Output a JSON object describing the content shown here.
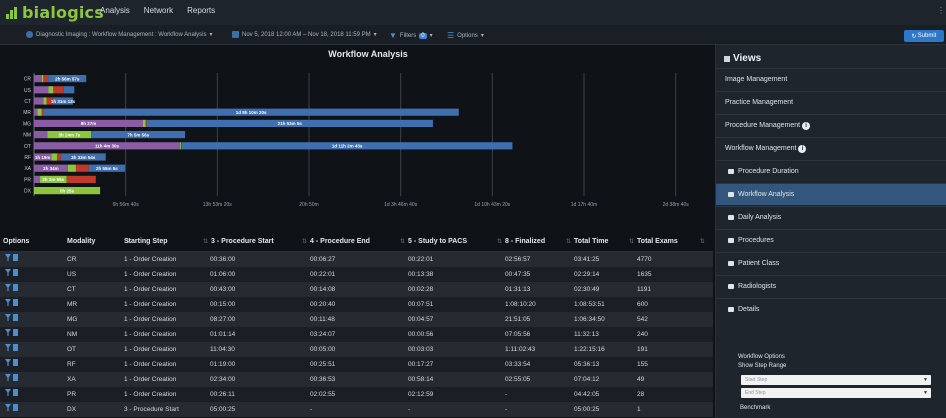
{
  "app": {
    "name": "bialogics"
  },
  "nav": [
    "Analysis",
    "Network",
    "Reports"
  ],
  "subbar": {
    "breadcrumb": "Diagnostic Imaging : Workflow Management : Workflow Analysis",
    "daterange": "Nov 5, 2018 12:00 AM – Nov 18, 2018 11:59 PM",
    "filters_label": "Filters",
    "filters_count": "0",
    "options_label": "Options",
    "submit_label": "Submit"
  },
  "chart_data": {
    "type": "bar",
    "orientation": "horizontal-stacked",
    "title": "Workflow Analysis",
    "categories": [
      "CR",
      "US",
      "CT",
      "MR",
      "MG",
      "NM",
      "OT",
      "RF",
      "XA",
      "PR",
      "DX"
    ],
    "x_tick_labels": [
      "6h 56m 40s",
      "13h 53m 20s",
      "20h 50m",
      "1d 3h 46m 40s",
      "1d 10h 43m 20s",
      "1d 17h 40m",
      "2d 38m 40s"
    ],
    "x_tick_seconds": [
      25000,
      50000,
      75000,
      100000,
      125000,
      150000,
      175000
    ],
    "xlim_seconds": [
      0,
      180000
    ],
    "grid": true,
    "series": [
      {
        "color": "#8a5ca3",
        "values": [
          2160,
          3960,
          2580,
          900,
          29700,
          3674,
          39840,
          4740,
          9240,
          1571,
          0
        ]
      },
      {
        "color": "#8cc63f",
        "values": [
          387,
          1321,
          848,
          1240,
          708,
          11927,
          300,
          1551,
          2193,
          7345,
          18025
        ]
      },
      {
        "color": "#c0392b",
        "values": [
          1321,
          2847,
          1733,
          471,
          297,
          56,
          183,
          1037,
          3494,
          7932,
          0
        ]
      },
      {
        "color": "#3f6fae",
        "values": [
          10377,
          2869,
          5483,
          113220,
          78095,
          25556,
          90163,
          12234,
          9909,
          0,
          0
        ]
      }
    ],
    "bar_labels": [
      {
        "row": 0,
        "series": 3,
        "text": "2h 56m 57s"
      },
      {
        "row": 2,
        "series": 3,
        "text": "1h 31m 13s"
      },
      {
        "row": 3,
        "series": 3,
        "text": "1d 8h 10m 20s"
      },
      {
        "row": 4,
        "series": 0,
        "text": "8h 27m"
      },
      {
        "row": 4,
        "series": 3,
        "text": "21h 53m 5s"
      },
      {
        "row": 5,
        "series": 1,
        "text": "3h 24m 7s"
      },
      {
        "row": 5,
        "series": 3,
        "text": "7h 5m 56s"
      },
      {
        "row": 6,
        "series": 0,
        "text": "11h 4m 30s"
      },
      {
        "row": 6,
        "series": 3,
        "text": "1d 11h 2m 43s"
      },
      {
        "row": 7,
        "series": 0,
        "text": "1h 19m"
      },
      {
        "row": 7,
        "series": 3,
        "text": "3h 33m 54s"
      },
      {
        "row": 8,
        "series": 0,
        "text": "2h 34m"
      },
      {
        "row": 8,
        "series": 3,
        "text": "2h 55m 5s"
      },
      {
        "row": 9,
        "series": 1,
        "text": "2h 2m 55s"
      },
      {
        "row": 10,
        "series": 1,
        "text": "5h 25s"
      }
    ]
  },
  "table": {
    "options_header": "Options",
    "headers": [
      "Modality",
      "Starting Step",
      "3 - Procedure Start",
      "4 - Procedure End",
      "5 - Study to PACS",
      "8 - Finalized",
      "Total Time",
      "Total Exams"
    ],
    "rows": [
      [
        "CR",
        "1 - Order Creation",
        "00:36:00",
        "00:06:27",
        "00:22:01",
        "02:56:57",
        "03:41:25",
        "4770"
      ],
      [
        "US",
        "1 - Order Creation",
        "01:06:00",
        "00:22:01",
        "00:13:38",
        "00:47:35",
        "02:29:14",
        "1635"
      ],
      [
        "CT",
        "1 - Order Creation",
        "00:43:00",
        "00:14:08",
        "00:02:28",
        "01:31:13",
        "02:30:49",
        "1191"
      ],
      [
        "MR",
        "1 - Order Creation",
        "00:15:00",
        "00:20:40",
        "00:07:51",
        "1:08:10:20",
        "1:08:53:51",
        "600"
      ],
      [
        "MG",
        "1 - Order Creation",
        "08:27:00",
        "00:11:48",
        "00:04:57",
        "21:51:05",
        "1:06:34:50",
        "542"
      ],
      [
        "NM",
        "1 - Order Creation",
        "01:01:14",
        "03:24:07",
        "00:00:56",
        "07:05:56",
        "11:32:13",
        "240"
      ],
      [
        "OT",
        "1 - Order Creation",
        "11:04:30",
        "00:05:00",
        "00:03:03",
        "1:11:02:43",
        "1:22:15:16",
        "191"
      ],
      [
        "RF",
        "1 - Order Creation",
        "01:19:00",
        "00:25:51",
        "00:17:27",
        "03:33:54",
        "05:36:13",
        "155"
      ],
      [
        "XA",
        "1 - Order Creation",
        "02:34:00",
        "00:36:53",
        "00:58:14",
        "02:55:05",
        "07:04:12",
        "49"
      ],
      [
        "PR",
        "1 - Order Creation",
        "00:26:11",
        "02:02:55",
        "02:12:59",
        "-",
        "04:42:05",
        "28"
      ],
      [
        "DX",
        "3 - Procedure Start",
        "05:00:25",
        "-",
        "-",
        "-",
        "05:00:25",
        "1"
      ]
    ]
  },
  "sidebar": {
    "title": "Views",
    "items": [
      {
        "label": "Image Management",
        "type": "top"
      },
      {
        "label": "Practice Management",
        "type": "top"
      },
      {
        "label": "Procedure Management",
        "type": "top",
        "info": true
      },
      {
        "label": "Workflow Management",
        "type": "top",
        "info": true
      },
      {
        "label": "Procedure Duration",
        "type": "sub"
      },
      {
        "label": "Workflow Analysis",
        "type": "sub",
        "active": true
      },
      {
        "label": "Daily Analysis",
        "type": "sub"
      },
      {
        "label": "Procedures",
        "type": "sub"
      },
      {
        "label": "Patient Class",
        "type": "sub"
      },
      {
        "label": "Radiologists",
        "type": "sub"
      },
      {
        "label": "Details",
        "type": "sub"
      }
    ],
    "options": {
      "heading": "Workflow Options",
      "step_range_label": "Show Step Range",
      "start_placeholder": "Start Step",
      "end_placeholder": "End Step",
      "benchmark_label": "Benchmark"
    }
  },
  "colors": {
    "accent": "#2e78c9",
    "brand": "#8cc63f",
    "active": "#33577c"
  }
}
